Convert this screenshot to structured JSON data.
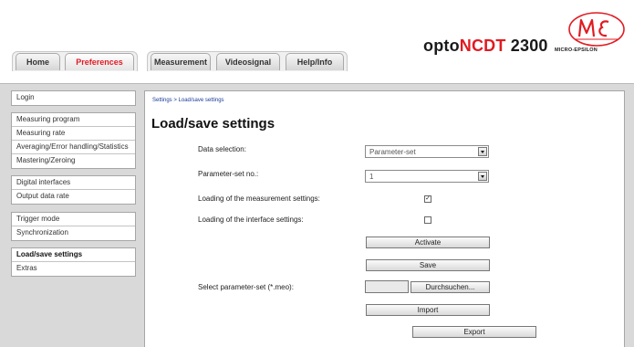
{
  "header": {
    "tabs": [
      {
        "label": "Home"
      },
      {
        "label": "Preferences"
      },
      {
        "label": "Measurement"
      },
      {
        "label": "Videosignal"
      },
      {
        "label": "Help/Info"
      }
    ],
    "brand_prefix": "opto",
    "brand_highlight": "NCDT",
    "brand_suffix": " 2300",
    "logo_text": "MICRO-EPSILON",
    "accent_color": "#e01b22"
  },
  "sidebar": {
    "groups": [
      {
        "items": [
          "Login"
        ]
      },
      {
        "items": [
          "Measuring program",
          "Measuring rate",
          "Averaging/Error handling/Statistics",
          "Mastering/Zeroing"
        ]
      },
      {
        "items": [
          "Digital interfaces",
          "Output data rate"
        ]
      },
      {
        "items": [
          "Trigger mode",
          "Synchronization"
        ]
      },
      {
        "items": [
          "Load/save settings",
          "Extras"
        ]
      }
    ],
    "active": "Load/save settings"
  },
  "main": {
    "breadcrumb": "Settings > Load/save settings",
    "title": "Load/save settings",
    "data_selection_label": "Data selection:",
    "data_selection_value": "Parameter-set",
    "param_set_label": "Parameter-set no.:",
    "param_set_value": "1",
    "load_measurement_label": "Loading of the measurement settings:",
    "load_measurement_checked": true,
    "load_interface_label": "Loading of the interface settings:",
    "load_interface_checked": false,
    "activate_label": "Activate",
    "save_label": "Save",
    "select_file_label": "Select parameter-set (*.meo):",
    "browse_label": "Durchsuchen...",
    "import_label": "Import",
    "export_label": "Export"
  }
}
